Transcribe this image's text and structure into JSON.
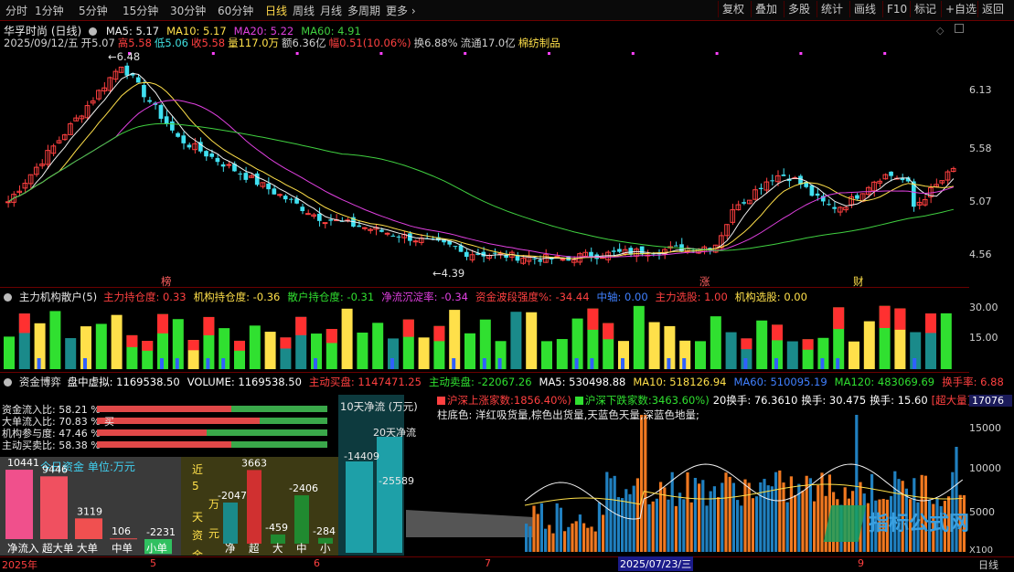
{
  "toolbar": {
    "left": [
      "分时",
      "1分钟",
      "5分钟",
      "15分钟",
      "30分钟",
      "60分钟",
      "日线",
      "周线",
      "月线",
      "多周期",
      "更多 ›"
    ],
    "active": "日线",
    "right": [
      "复权",
      "叠加",
      "多股",
      "统计",
      "画线",
      "F10",
      "标记",
      "+自选",
      "返回"
    ]
  },
  "stock": {
    "name": "华孚时尚 (日线)",
    "ma_labels": [
      {
        "text": "MA5: 5.17",
        "color": "#f0f0f0"
      },
      {
        "text": "MA10: 5.17",
        "color": "#ffe04a"
      },
      {
        "text": "MA20: 5.22",
        "color": "#e040e0"
      },
      {
        "text": "MA60: 4.91",
        "color": "#40d040"
      }
    ],
    "info": [
      {
        "text": "2025/09/12/五",
        "color": "#d0d0d0"
      },
      {
        "text": "开5.07",
        "color": "#d0d0d0"
      },
      {
        "text": "高5.58",
        "color": "#ff4040"
      },
      {
        "text": "低5.06",
        "color": "#40e0e0"
      },
      {
        "text": "收5.58",
        "color": "#ff4040"
      },
      {
        "text": "量117.0万",
        "color": "#ffe04a"
      },
      {
        "text": "额6.36亿",
        "color": "#d0d0d0"
      },
      {
        "text": "幅0.51(10.06%)",
        "color": "#ff4040"
      },
      {
        "text": "换6.88%",
        "color": "#d0d0d0"
      },
      {
        "text": "流通17.0亿",
        "color": "#d0d0d0"
      },
      {
        "text": "棉纺制品",
        "color": "#ffe04a"
      }
    ],
    "price_axis": [
      "6.13",
      "5.58",
      "5.07",
      "4.56"
    ],
    "high_label": "6.48",
    "low_label": "4.39",
    "markers": [
      {
        "text": "榜",
        "color": "#ff6060"
      },
      {
        "text": "涨",
        "color": "#ff6060"
      },
      {
        "text": "财",
        "color": "#ffe04a"
      }
    ],
    "watermark": "指标公式网"
  },
  "panel2": {
    "title": "主力机构散户(5)",
    "items": [
      {
        "text": "主力持仓度: 0.33",
        "color": "#ff4040"
      },
      {
        "text": "机构持仓度: -0.36",
        "color": "#ffe04a"
      },
      {
        "text": "散户持仓度: -0.31",
        "color": "#30e030"
      },
      {
        "text": "净流沉淀率: -0.34",
        "color": "#e040e0"
      },
      {
        "text": "资金波段强度%: -34.44",
        "color": "#ff4040"
      },
      {
        "text": "中轴: 0.00",
        "color": "#4080ff"
      },
      {
        "text": "主力选股: 1.00",
        "color": "#ff4040"
      },
      {
        "text": "机构选股: 0.00",
        "color": "#ffe04a"
      }
    ],
    "axis": [
      "30.00",
      "15.00"
    ]
  },
  "panel3": {
    "title": "资金博弈",
    "items": [
      {
        "text": "盘中虚拟: 1169538.50",
        "color": "#ffffff"
      },
      {
        "text": "VOLUME: 1169538.50",
        "color": "#ffffff"
      },
      {
        "text": "主动买盘: 1147471.25",
        "color": "#ff4040"
      },
      {
        "text": "主动卖盘: -22067.26",
        "color": "#30e030"
      },
      {
        "text": "MA5: 530498.88",
        "color": "#ffffff"
      },
      {
        "text": "MA10: 518126.94",
        "color": "#ffe04a"
      },
      {
        "text": "MA60: 510095.19",
        "color": "#4080ff"
      },
      {
        "text": "MA120: 483069.69",
        "color": "#30e030"
      },
      {
        "text": "换手率: 6.88",
        "color": "#ff4040"
      },
      {
        "text": "量比",
        "color": "#4080ff"
      }
    ],
    "ratios": [
      {
        "label": "资金流入比: 58.21 %",
        "value": 58.21
      },
      {
        "label": "大单流入比: 70.83 %",
        "value": 70.83,
        "tag": "买"
      },
      {
        "label": "机构参与度: 47.46 %",
        "value": 47.46
      },
      {
        "label": "主动买卖比: 58.38 %",
        "value": 58.38
      }
    ],
    "today": {
      "title": "今日资金 单位:万元",
      "bars": [
        {
          "label": "净流入",
          "value": 10441,
          "color": "#f0508c"
        },
        {
          "label": "超大单",
          "value": 9446,
          "color": "#f05060"
        },
        {
          "label": "大单",
          "value": 3119,
          "color": "#f05050"
        },
        {
          "label": "中单",
          "value": 106,
          "color": "#f05050"
        },
        {
          "label": "小单",
          "value": -2231,
          "color": "#30c060"
        }
      ]
    },
    "five_day": {
      "title_chars": [
        "近",
        "5",
        "天",
        "万",
        "元",
        "资",
        "金"
      ],
      "bars": [
        {
          "label": "净",
          "value": -2047,
          "color": "#1a8a8a"
        },
        {
          "label": "超",
          "value": 3663,
          "color": "#d03030"
        },
        {
          "label": "大",
          "value": -459,
          "color": "#208a30"
        },
        {
          "label": "中",
          "value": -2406,
          "color": "#208a30"
        },
        {
          "label": "小",
          "value": -284,
          "color": "#208a30"
        }
      ]
    },
    "ten_day": {
      "title": "10天净流 (万元)",
      "value": -14409
    },
    "twenty_day": {
      "title": "20天净流",
      "value": -25589
    },
    "legend": [
      {
        "text": "沪深上涨家数:1856.40%)",
        "color": "#ff4040"
      },
      {
        "text": "沪深下跌家数:3463.60%)",
        "color": "#30e030"
      },
      {
        "text": "20换手: 76.3610",
        "color": "#ffffff"
      },
      {
        "text": "换手: 30.475",
        "color": "#ffffff"
      },
      {
        "text": "换手: 15.60",
        "color": "#ffffff"
      },
      {
        "text": "[超大量]",
        "color": "#ff4040"
      }
    ],
    "note": "柱底色: 洋红吸货量,棕色出货量,天蓝色天量,深蓝色地量;",
    "axis": [
      "17076",
      "15000",
      "10000",
      "5000"
    ],
    "axis_unit": "X100"
  },
  "time_axis": {
    "labels": [
      "2025年",
      "5",
      "6",
      "7",
      "2025/07/23/三",
      "9"
    ],
    "period": "日线"
  },
  "chart_data": {
    "type": "candlestick",
    "title": "华孚时尚 (日线)",
    "ylim": [
      4.39,
      6.48
    ],
    "price_ticks": [
      6.13,
      5.58,
      5.07,
      4.56
    ],
    "last": {
      "date": "2025/09/12",
      "open": 5.07,
      "high": 5.58,
      "low": 5.06,
      "close": 5.58
    },
    "ma": {
      "MA5": 5.17,
      "MA10": 5.17,
      "MA20": 5.22,
      "MA60": 4.91
    }
  }
}
